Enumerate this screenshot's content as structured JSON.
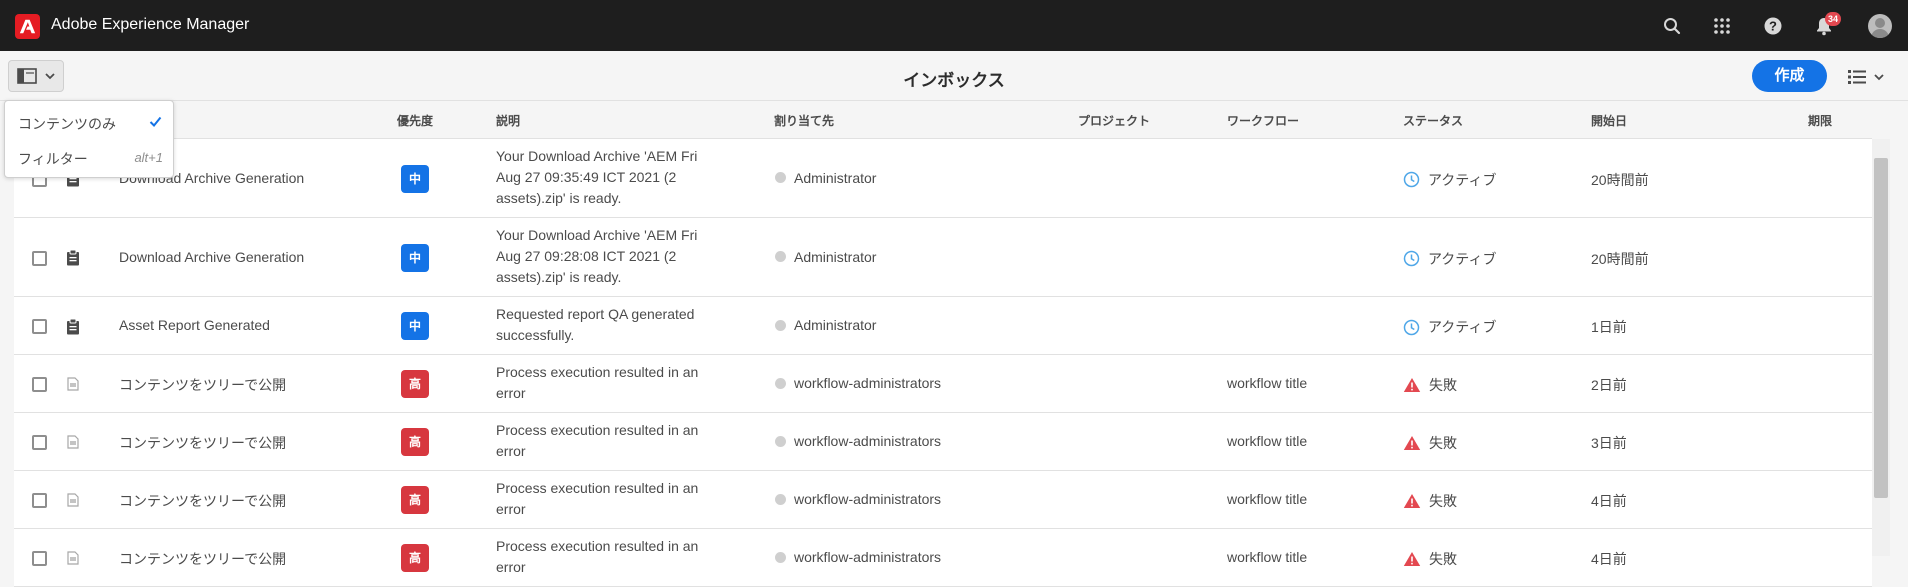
{
  "shell": {
    "app_title": "Adobe Experience Manager",
    "notification_count": "34",
    "icons": [
      "search-icon",
      "apps-grid-icon",
      "help-icon",
      "bell-icon",
      "avatar"
    ]
  },
  "actionbar": {
    "page_title": "インボックス",
    "create_label": "作成"
  },
  "popover": {
    "items": [
      {
        "label": "コンテンツのみ",
        "checked": true
      },
      {
        "label": "フィルター",
        "shortcut": "alt+1"
      }
    ]
  },
  "table": {
    "headers": {
      "priority": "優先度",
      "description": "説明",
      "assignee": "割り当て先",
      "project": "プロジェクト",
      "workflow": "ワークフロー",
      "status": "ステータス",
      "start_date": "開始日",
      "due": "期限"
    },
    "rows": [
      {
        "title": "Download Archive Generation",
        "priority": "中",
        "priority_level": "mid",
        "desc_lines": [
          "Your Download Archive 'AEM Fri",
          "Aug 27 09:35:49 ICT 2021 (2",
          "assets).zip' is ready."
        ],
        "assignee": "Administrator",
        "workflow": "",
        "status": "アクティブ",
        "status_type": "active",
        "start": "20時間前",
        "icon": "clipboard-icon"
      },
      {
        "title": "Download Archive Generation",
        "priority": "中",
        "priority_level": "mid",
        "desc_lines": [
          "Your Download Archive 'AEM Fri",
          "Aug 27 09:28:08 ICT 2021 (2",
          "assets).zip' is ready."
        ],
        "assignee": "Administrator",
        "workflow": "",
        "status": "アクティブ",
        "status_type": "active",
        "start": "20時間前",
        "icon": "clipboard-icon"
      },
      {
        "title": "Asset Report Generated",
        "priority": "中",
        "priority_level": "mid",
        "desc_lines": [
          "Requested report QA generated",
          "successfully."
        ],
        "assignee": "Administrator",
        "workflow": "",
        "status": "アクティブ",
        "status_type": "active",
        "start": "1日前",
        "icon": "clipboard-icon"
      },
      {
        "title": "コンテンツをツリーで公開",
        "priority": "高",
        "priority_level": "high",
        "desc_lines": [
          "Process execution resulted in an",
          "error"
        ],
        "assignee": "workflow-administrators",
        "workflow": "workflow title",
        "status": "失敗",
        "status_type": "failed",
        "start": "2日前",
        "icon": "document-icon"
      },
      {
        "title": "コンテンツをツリーで公開",
        "priority": "高",
        "priority_level": "high",
        "desc_lines": [
          "Process execution resulted in an",
          "error"
        ],
        "assignee": "workflow-administrators",
        "workflow": "workflow title",
        "status": "失敗",
        "status_type": "failed",
        "start": "3日前",
        "icon": "document-icon"
      },
      {
        "title": "コンテンツをツリーで公開",
        "priority": "高",
        "priority_level": "high",
        "desc_lines": [
          "Process execution resulted in an",
          "error"
        ],
        "assignee": "workflow-administrators",
        "workflow": "workflow title",
        "status": "失敗",
        "status_type": "failed",
        "start": "4日前",
        "icon": "document-icon"
      },
      {
        "title": "コンテンツをツリーで公開",
        "priority": "高",
        "priority_level": "high",
        "desc_lines": [
          "Process execution resulted in an",
          "error"
        ],
        "assignee": "workflow-administrators",
        "workflow": "workflow title",
        "status": "失敗",
        "status_type": "failed",
        "start": "4日前",
        "icon": "document-icon"
      }
    ]
  },
  "colors": {
    "shell_bg": "#1e1e1e",
    "accent_blue": "#1473e6",
    "priority_high": "#d7373f",
    "status_active": "#4fa7e8",
    "status_failed": "#e34850"
  }
}
